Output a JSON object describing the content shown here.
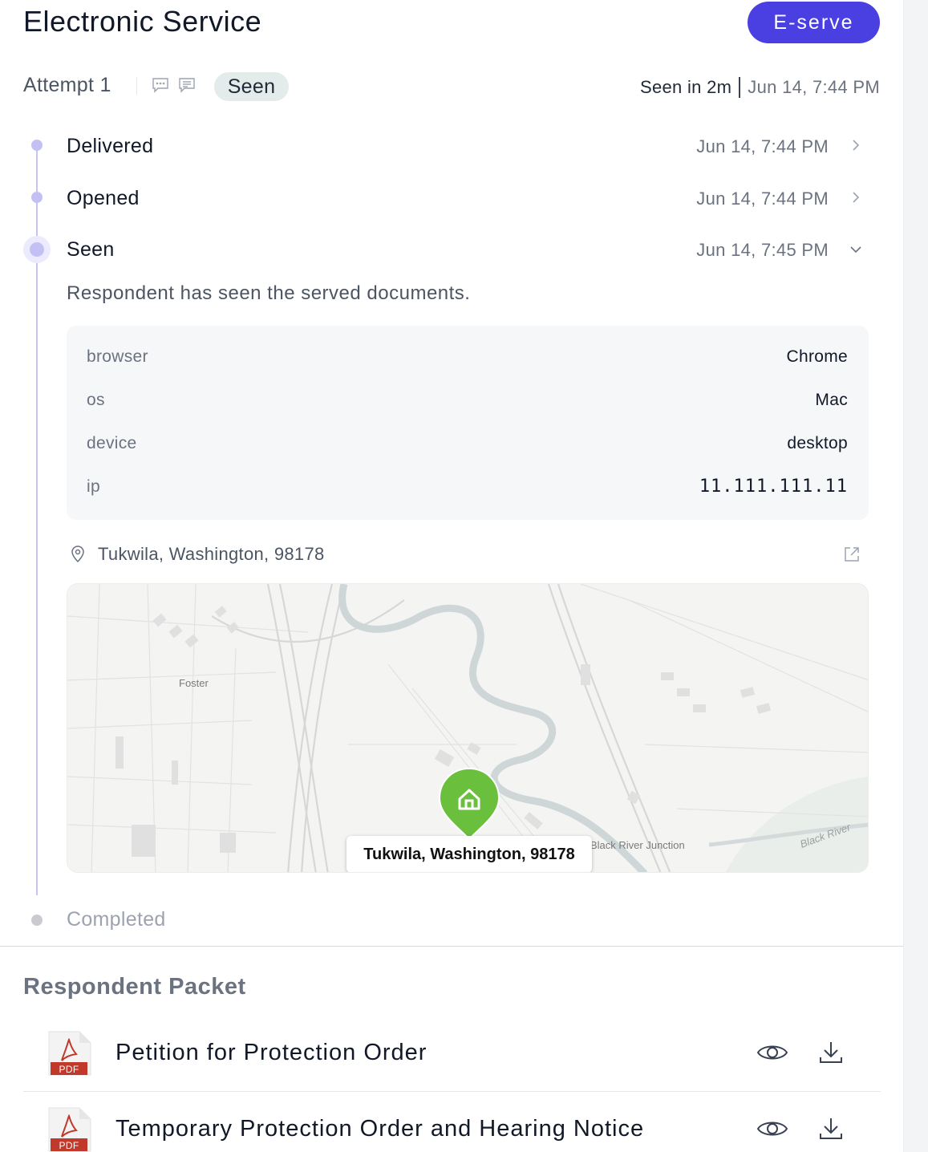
{
  "header": {
    "title": "Electronic Service",
    "eserve_label": "E-serve"
  },
  "attempt": {
    "label": "Attempt 1",
    "status_badge": "Seen",
    "seen_in": "Seen in 2m",
    "seen_timestamp": "Jun 14, 7:44 PM"
  },
  "timeline": {
    "events": [
      {
        "label": "Delivered",
        "time": "Jun 14, 7:44 PM"
      },
      {
        "label": "Opened",
        "time": "Jun 14, 7:44 PM"
      },
      {
        "label": "Seen",
        "time": "Jun 14, 7:45 PM",
        "description": "Respondent has seen the served documents."
      }
    ],
    "completed_label": "Completed"
  },
  "meta": {
    "rows": [
      {
        "key": "browser",
        "value": "Chrome"
      },
      {
        "key": "os",
        "value": "Mac"
      },
      {
        "key": "device",
        "value": "desktop"
      },
      {
        "key": "ip",
        "value": "11.111.111.11"
      }
    ]
  },
  "location": {
    "text": "Tukwila, Washington, 98178",
    "map_tooltip": "Tukwila, Washington, 98178",
    "map_labels": {
      "foster": "Foster",
      "black_river_junction": "Black River Junction",
      "black_river": "Black River"
    }
  },
  "packet": {
    "title": "Respondent Packet",
    "pdf_label": "PDF",
    "documents": [
      {
        "name": "Petition for Protection Order"
      },
      {
        "name": "Temporary Protection Order and Hearing Notice"
      }
    ]
  },
  "colors": {
    "accent": "#4a3fe0",
    "timeline": "#c4c0f4",
    "marker": "#6abf3c",
    "pdf_red": "#c0392b"
  }
}
